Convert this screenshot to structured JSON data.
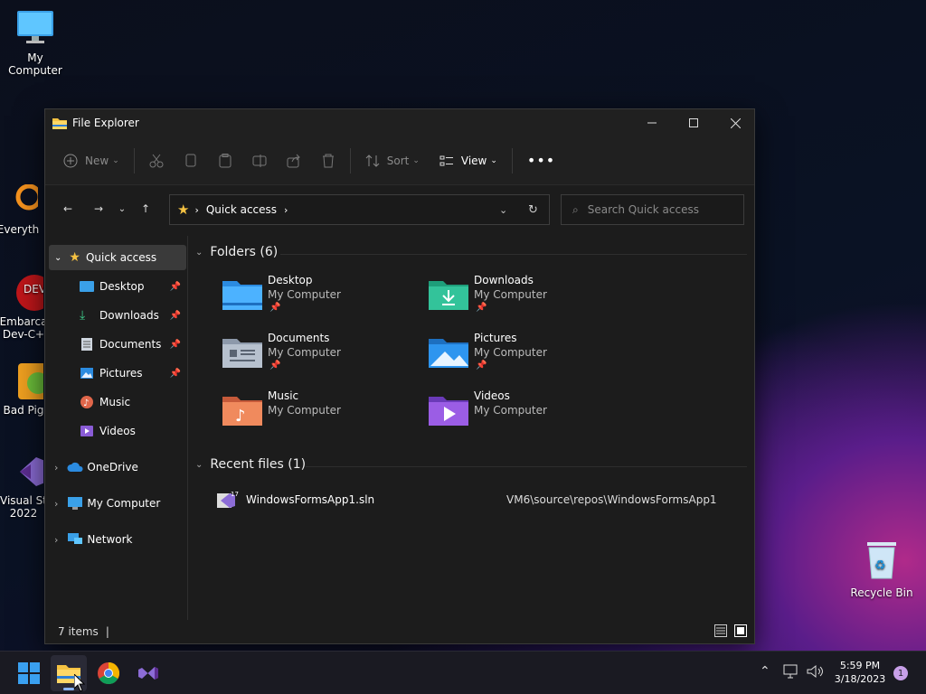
{
  "desktop": {
    "icons": [
      {
        "label": "My Computer"
      },
      {
        "label": "Everyth"
      },
      {
        "label": "Embarca\nDev-C+"
      },
      {
        "label": "Bad Pig"
      },
      {
        "label": "Visual St\n2022"
      },
      {
        "label": "Recycle Bin"
      }
    ]
  },
  "window": {
    "title": "File Explorer"
  },
  "toolbar": {
    "new_label": "New",
    "sort_label": "Sort",
    "view_label": "View"
  },
  "address": {
    "root_label": "Quick access"
  },
  "search": {
    "placeholder": "Search Quick access"
  },
  "sidebar": {
    "items": [
      {
        "label": "Quick access",
        "icon": "star-icon"
      },
      {
        "label": "Desktop",
        "icon": "desktop-icon",
        "pinned": true
      },
      {
        "label": "Downloads",
        "icon": "download-icon",
        "pinned": true
      },
      {
        "label": "Documents",
        "icon": "documents-icon",
        "pinned": true
      },
      {
        "label": "Pictures",
        "icon": "pictures-icon",
        "pinned": true
      },
      {
        "label": "Music",
        "icon": "music-icon"
      },
      {
        "label": "Videos",
        "icon": "videos-icon"
      },
      {
        "label": "OneDrive",
        "icon": "cloud-icon"
      },
      {
        "label": "My Computer",
        "icon": "computer-icon"
      },
      {
        "label": "Network",
        "icon": "network-icon"
      }
    ]
  },
  "folders_section": {
    "title": "Folders (6)"
  },
  "folders": [
    {
      "name": "Desktop",
      "location": "My Computer",
      "pinned": true
    },
    {
      "name": "Downloads",
      "location": "My Computer",
      "pinned": true
    },
    {
      "name": "Documents",
      "location": "My Computer",
      "pinned": true
    },
    {
      "name": "Pictures",
      "location": "My Computer",
      "pinned": true
    },
    {
      "name": "Music",
      "location": "My Computer"
    },
    {
      "name": "Videos",
      "location": "My Computer"
    }
  ],
  "recent_section": {
    "title": "Recent files (1)"
  },
  "recent_files": [
    {
      "name": "WindowsFormsApp1.sln",
      "path": "VM6\\source\\repos\\WindowsFormsApp1"
    }
  ],
  "status": {
    "items": "7 items"
  },
  "tray": {
    "time": "5:59 PM",
    "date": "3/18/2023",
    "notifications": "1"
  },
  "colors": {
    "accent": "#0078d4",
    "window_bg": "#1c1c1c",
    "selected": "#3a3a3a"
  }
}
